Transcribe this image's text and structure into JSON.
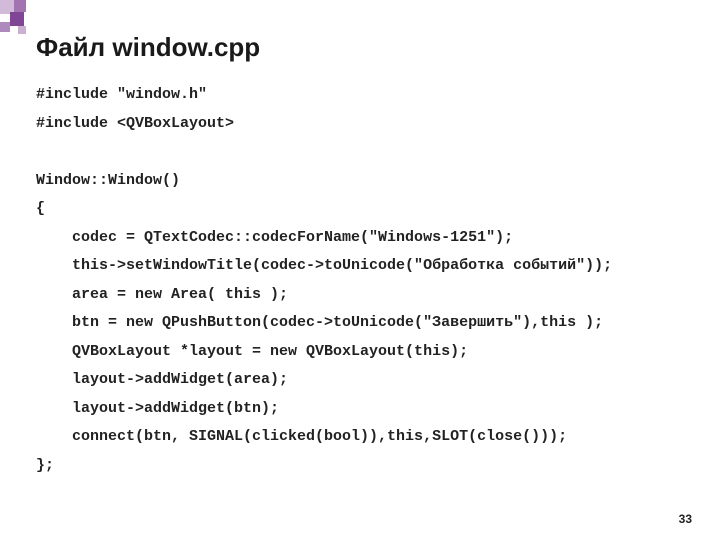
{
  "title": "Файл window.cpp",
  "code_lines": [
    "#include \"window.h\"",
    "#include <QVBoxLayout>",
    "",
    "Window::Window()",
    "{",
    "    codec = QTextCodec::codecForName(\"Windows-1251\");",
    "    this->setWindowTitle(codec->toUnicode(\"Обработка событий\"));",
    "    area = new Area( this );",
    "    btn = new QPushButton(codec->toUnicode(\"Завершить\"),this );",
    "    QVBoxLayout *layout = new QVBoxLayout(this);",
    "    layout->addWidget(area);",
    "    layout->addWidget(btn);",
    "    connect(btn, SIGNAL(clicked(bool)),this,SLOT(close()));",
    "};"
  ],
  "page_number": "33"
}
